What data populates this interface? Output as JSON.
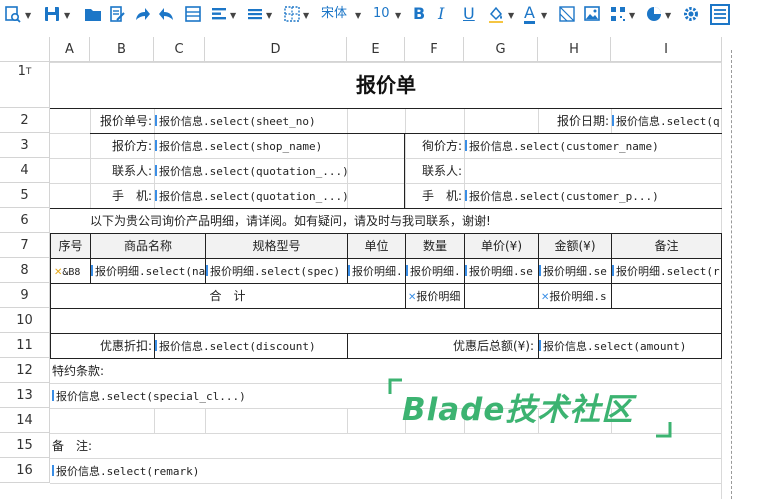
{
  "toolbar": {
    "font_family": "宋体",
    "font_size": "10",
    "bold": "B",
    "italic": "I",
    "underline": "U",
    "font_color": "A"
  },
  "sheet": {
    "columns": [
      "A",
      "B",
      "C",
      "D",
      "E",
      "F",
      "G",
      "H",
      "I"
    ],
    "rows": [
      "1",
      "2",
      "3",
      "4",
      "5",
      "6",
      "7",
      "8",
      "9",
      "10",
      "11",
      "12",
      "13",
      "14",
      "15",
      "16"
    ],
    "title": "报价单",
    "r2": {
      "sheet_no_label": "报价单号:",
      "sheet_no_value": "报价信息.select(sheet_no)",
      "date_label": "报价日期:",
      "date_value": "报价信息.select(q"
    },
    "r3": {
      "quoter_label": "报价方:",
      "quoter_value": "报价信息.select(shop_name)",
      "customer_label": "徇价方:",
      "customer_value": "报价信息.select(customer_name)"
    },
    "r4": {
      "contact_label": "联系人:",
      "contact_value": "报价信息.select(quotation_...)",
      "contact2_label": "联系人:"
    },
    "r5": {
      "phone_label": "手　机:",
      "phone_value": "报价信息.select(quotation_...)",
      "phone2_label": "手　机:",
      "phone2_value": "报价信息.select(customer_p...)"
    },
    "r6": {
      "intro": "以下为贵公司询价产品明细，请详阅。如有疑问，请及时与我司联系，谢谢!"
    },
    "r7": {
      "headers": [
        "序号",
        "商品名称",
        "规格型号",
        "单位",
        "数量",
        "单价(¥)",
        "金额(¥)",
        "备注"
      ]
    },
    "r8": {
      "cells": [
        "&B8",
        "报价明细.select(na",
        "报价明细.select(spec)",
        "报价明细.",
        "报价明细.",
        "报价明细.se",
        "报价明细.se",
        "报价明细.select(r"
      ]
    },
    "r9": {
      "total_label": "合　计",
      "qty_sum": "报价明细",
      "amount_sum": "报价明细.s"
    },
    "r11": {
      "discount_label": "优惠折扣:",
      "discount_value": "报价信息.select(discount)",
      "after_label": "优惠后总额(¥):",
      "after_value": "报价信息.select(amount)"
    },
    "r12": {
      "terms_label": "特约条款:"
    },
    "r13": {
      "terms_value": "报价信息.select(special_cl...)"
    },
    "r15": {
      "remark_label": "备　注:"
    },
    "r16": {
      "remark_value": "报价信息.select(remark)"
    }
  },
  "row1_marker": "T",
  "watermark": {
    "text": "Blade技术社区",
    "color": "#3cb371"
  },
  "colors": {
    "toolbar_icon": "#1c76c7",
    "header_fill": "#f2f2f2",
    "bind_marker": "#3a8ee6"
  }
}
